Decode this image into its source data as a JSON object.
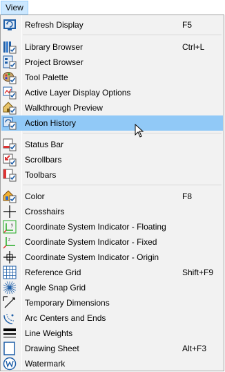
{
  "menubar": {
    "view_label": "View"
  },
  "menu": {
    "items": [
      {
        "label": "Refresh Display",
        "shortcut": "F5",
        "icon": "refresh-display-icon"
      },
      {
        "label": "Library Browser",
        "shortcut": "Ctrl+L",
        "icon": "library-browser-icon"
      },
      {
        "label": "Project Browser",
        "shortcut": "",
        "icon": "project-browser-icon"
      },
      {
        "label": "Tool Palette",
        "shortcut": "",
        "icon": "tool-palette-icon"
      },
      {
        "label": "Active Layer Display Options",
        "shortcut": "",
        "icon": "layer-display-icon"
      },
      {
        "label": "Walkthrough Preview",
        "shortcut": "",
        "icon": "walkthrough-preview-icon"
      },
      {
        "label": "Action History",
        "shortcut": "",
        "icon": "action-history-icon"
      },
      {
        "label": "Status Bar",
        "shortcut": "",
        "icon": "status-bar-icon"
      },
      {
        "label": "Scrollbars",
        "shortcut": "",
        "icon": "scrollbars-icon"
      },
      {
        "label": "Toolbars",
        "shortcut": "",
        "icon": "toolbars-icon"
      },
      {
        "label": "Color",
        "shortcut": "F8",
        "icon": "color-icon"
      },
      {
        "label": "Crosshairs",
        "shortcut": "",
        "icon": "crosshairs-icon"
      },
      {
        "label": "Coordinate System Indicator - Floating",
        "shortcut": "",
        "icon": "coordinate-floating-icon"
      },
      {
        "label": "Coordinate System Indicator - Fixed",
        "shortcut": "",
        "icon": "coordinate-fixed-icon"
      },
      {
        "label": "Coordinate System Indicator - Origin",
        "shortcut": "",
        "icon": "coordinate-origin-icon"
      },
      {
        "label": "Reference Grid",
        "shortcut": "Shift+F9",
        "icon": "reference-grid-icon"
      },
      {
        "label": "Angle Snap Grid",
        "shortcut": "",
        "icon": "angle-snap-grid-icon"
      },
      {
        "label": "Temporary Dimensions",
        "shortcut": "",
        "icon": "temporary-dimensions-icon"
      },
      {
        "label": "Arc Centers and Ends",
        "shortcut": "",
        "icon": "arc-centers-icon"
      },
      {
        "label": "Line Weights",
        "shortcut": "",
        "icon": "line-weights-icon"
      },
      {
        "label": "Drawing Sheet",
        "shortcut": "Alt+F3",
        "icon": "drawing-sheet-icon"
      },
      {
        "label": "Watermark",
        "shortcut": "",
        "icon": "watermark-icon"
      }
    ],
    "highlighted": "Action History",
    "colors": {
      "highlight": "#91c9f7",
      "menu_bg": "#f2f2f2",
      "menubar_active": "#cce8ff",
      "icon_blue": "#1f5fa8"
    }
  }
}
